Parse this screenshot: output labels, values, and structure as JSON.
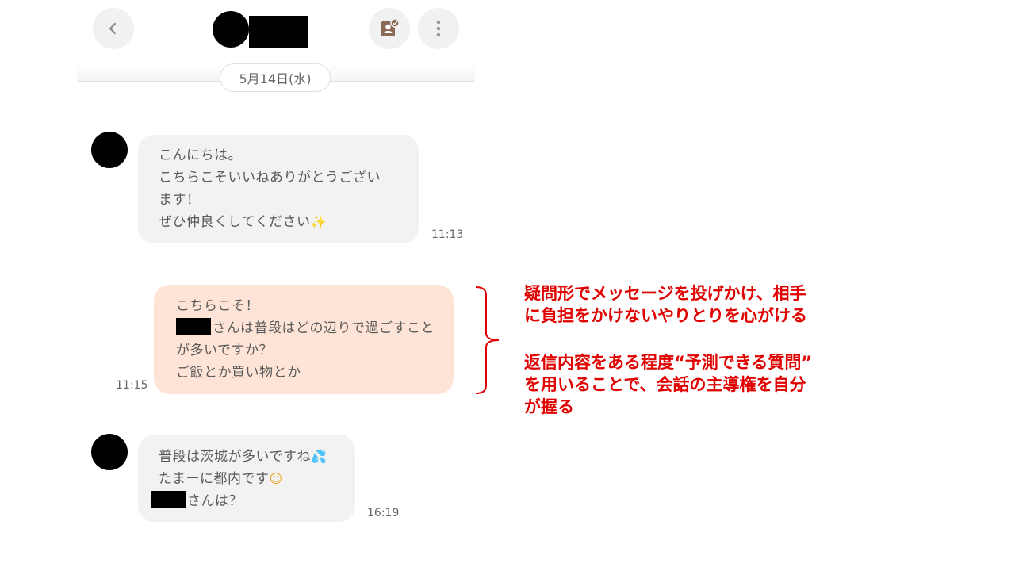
{
  "header": {
    "back_icon": "chevron-left-icon",
    "profile_icon": "profile-card-icon",
    "more_icon": "vertical-dots-icon",
    "date_label": "5月14日(水)"
  },
  "messages": [
    {
      "direction": "incoming",
      "lines": [
        "こんにちは。",
        "こちらこそいいねありがとうござい",
        "ます！",
        "ぜひ仲良くしてください"
      ],
      "emoji": "✨",
      "time": "11:13"
    },
    {
      "direction": "outgoing",
      "lines": [
        "こちらこそ！",
        "さんは普段はどの辺りで過ごすこと",
        "が多いですか？",
        "ご飯とか買い物とか"
      ],
      "time": "11:15"
    },
    {
      "direction": "incoming",
      "lines": [
        "普段は茨城が多いですね",
        "たまーに都内です",
        "さんは？"
      ],
      "emojis": [
        "💦",
        "☺"
      ],
      "time": "16:19"
    }
  ],
  "annotation": {
    "color": "#e00000",
    "block1": [
      "疑問形でメッセージを投げかけ、相手",
      "に負担をかけないやりとりを心がける"
    ],
    "block2": [
      "返信内容をある程度“予測できる質問”",
      "を用いることで、会話の主導権を自分",
      "が握る"
    ]
  },
  "colors": {
    "incoming_bubble": "#f2f2f2",
    "outgoing_bubble": "#fde4d6",
    "button_bg": "#f1f1f1",
    "annotation_red": "#e00000"
  }
}
